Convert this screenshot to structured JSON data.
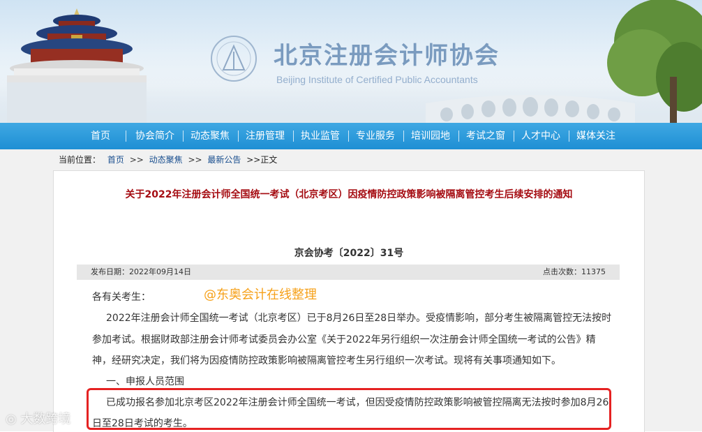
{
  "header": {
    "site_title": "北京注册会计师协会",
    "site_subtitle": "Beijing Institute of Certified Public Accountants"
  },
  "nav": {
    "items": [
      {
        "label": "首页"
      },
      {
        "label": "协会简介"
      },
      {
        "label": "动态聚焦"
      },
      {
        "label": "注册管理"
      },
      {
        "label": "执业监管"
      },
      {
        "label": "专业服务"
      },
      {
        "label": "培训园地"
      },
      {
        "label": "考试之窗"
      },
      {
        "label": "人才中心"
      },
      {
        "label": "媒体关注"
      }
    ]
  },
  "breadcrumb": {
    "prefix": "当前位置：",
    "items": [
      "首页",
      "动态聚焦",
      "最新公告"
    ],
    "separator": ">>",
    "current": ">>正文"
  },
  "article": {
    "title": "关于2022年注册会计师全国统一考试（北京考区）因疫情防控政策影响被隔离管控考生后续安排的通知",
    "doc_number": "京会协考〔2022〕31号",
    "publish_date": "发布日期：2022年09月14日",
    "click_count": "点击次数：11375",
    "salutation": "各有关考生：",
    "lines": [
      "2022年注册会计师全国统一考试（北京考区）已于8月26日至28日举办。受疫情影响，部分考生被隔离管控无法按时",
      "参加考试。根据财政部注册会计师考试委员会办公室《关于2022年另行组织一次注册会计师全国统一考试的公告》精",
      "神，经研究决定，我们将为因疫情防控政策影响被隔离管控考生另行组织一次考试。现将有关事项通知如下。",
      "一、申报人员范围",
      "已成功报名参加北京考区2022年注册会计师全国统一考试，但因受疫情防控政策影响被管控隔离无法按时参加8月26",
      "日至28日考试的考生。"
    ]
  },
  "overlay": {
    "watermark_text": "@东奥会计在线整理",
    "corner_logo": "大数跨境"
  },
  "colors": {
    "nav_bg": "#1e8fd4",
    "title_red": "#a50c12",
    "highlight_border": "#e52222",
    "watermark_orange": "#f6a11a"
  }
}
